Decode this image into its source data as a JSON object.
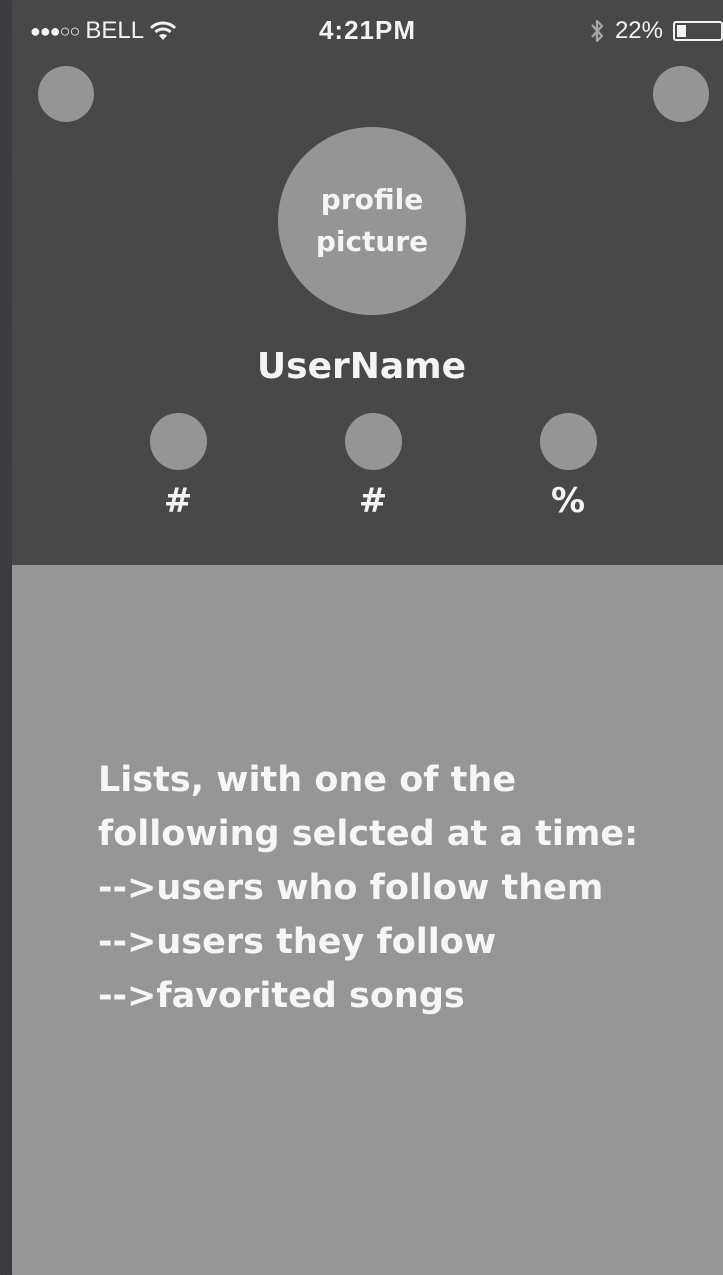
{
  "status_bar": {
    "signal": "●●●○○",
    "carrier": "BELL",
    "wifi_icon": "wifi-icon",
    "time": "4:21PM",
    "bluetooth_icon": "bluetooth-icon",
    "battery_percent": "22%",
    "battery_level": 0.22
  },
  "header": {
    "left_button_icon": "circle-placeholder",
    "right_button_icon": "circle-placeholder",
    "avatar_label": "profile picture",
    "username": "UserName",
    "stats": [
      {
        "value": "#"
      },
      {
        "value": "#"
      },
      {
        "value": "%"
      }
    ]
  },
  "content": {
    "lines": [
      "Lists, with one of the",
      "following selcted at a time:",
      "-->users who follow them",
      "-->users they follow",
      "-->favorited songs"
    ]
  },
  "colors": {
    "header_bg": "#484848",
    "placeholder": "#959595",
    "content_bg": "#969696",
    "text": "#f4f4f4"
  }
}
